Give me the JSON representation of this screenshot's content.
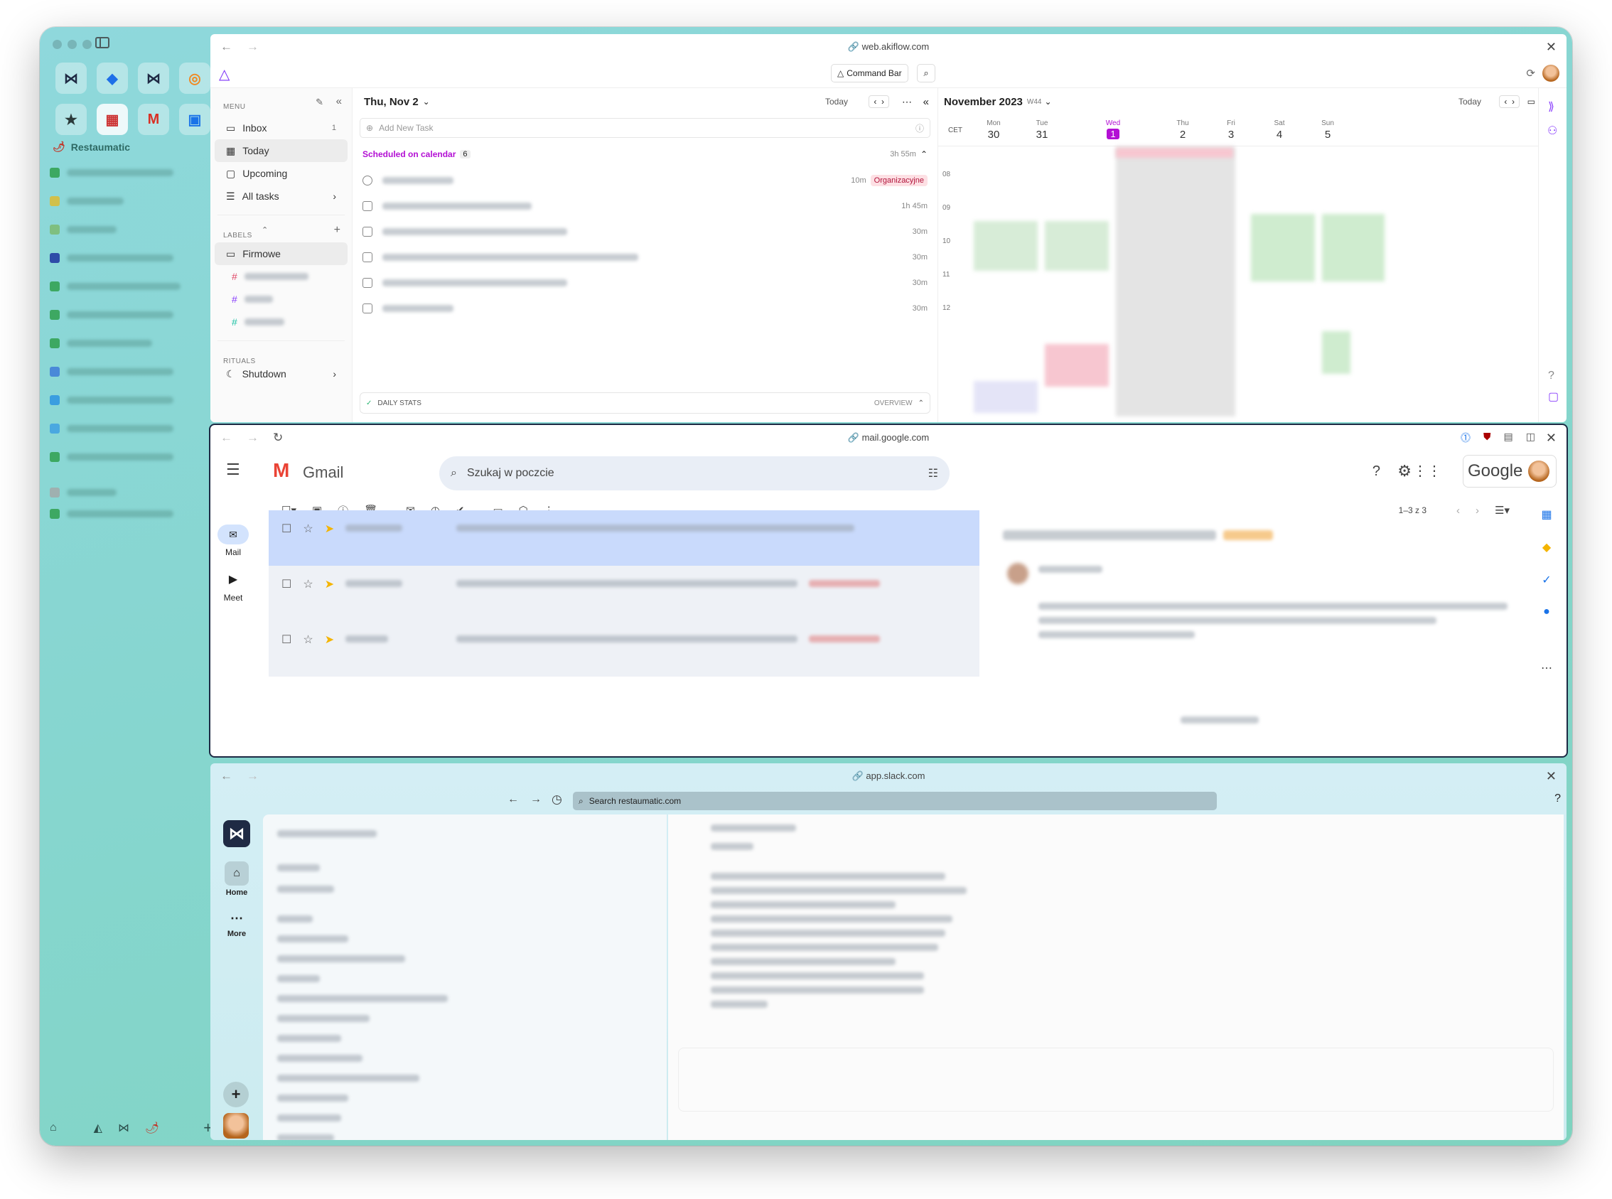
{
  "sidebar": {
    "space_name": "Restaumatic",
    "favorites": [
      {
        "icon": "bowtie-icon",
        "glyph": "⋈",
        "color": "#1f2a44"
      },
      {
        "icon": "jira-icon",
        "glyph": "◆",
        "color": "#1e6fe8"
      },
      {
        "icon": "bowtie-icon",
        "glyph": "⋈",
        "color": "#1f2a44"
      },
      {
        "icon": "app-icon",
        "glyph": "◎",
        "color": "#f08a24"
      },
      {
        "icon": "star-icon",
        "glyph": "★",
        "color": "#2b3a3a"
      },
      {
        "icon": "group-icon",
        "glyph": "▦",
        "color": "#c33"
      },
      {
        "icon": "gmail-icon",
        "glyph": "M",
        "color": "#d93025"
      },
      {
        "icon": "calendar-icon",
        "glyph": "▣",
        "color": "#1a73e8"
      }
    ],
    "tab_dots": [
      "#3da862",
      "#d1c04b",
      "#7fbf80",
      "#2e4ca8",
      "#3da862",
      "#3da862",
      "#3da862",
      "#4a89d8",
      "#3a9ee0",
      "#4aa8e0",
      "#3da862",
      "#9fb0b0",
      "#3da862"
    ]
  },
  "akiflow": {
    "url": "web.akiflow.com",
    "command_bar": "Command Bar",
    "menu_label": "MENU",
    "menu": [
      {
        "label": "Inbox",
        "count": "1"
      },
      {
        "label": "Today",
        "count": ""
      },
      {
        "label": "Upcoming",
        "count": ""
      },
      {
        "label": "All tasks",
        "count": ""
      }
    ],
    "labels_label": "LABELS",
    "label_group": "Firmowe",
    "rituals_label": "RITUALS",
    "ritual": "Shutdown",
    "date_title": "Thu, Nov 2",
    "today_btn": "Today",
    "add_task": "Add New Task",
    "scheduled": "Scheduled on calendar",
    "scheduled_count": "6",
    "scheduled_total": "3h 55m",
    "tasks": [
      {
        "dur": "10m",
        "tag": "Organizacyjne"
      },
      {
        "dur": "1h 45m",
        "tag": ""
      },
      {
        "dur": "30m",
        "tag": ""
      },
      {
        "dur": "30m",
        "tag": ""
      },
      {
        "dur": "30m",
        "tag": ""
      },
      {
        "dur": "30m",
        "tag": ""
      }
    ],
    "daily_stats": "DAILY STATS",
    "overview": "OVERVIEW",
    "cal_title": "November 2023",
    "cal_week": "W44",
    "cal_today": "Today",
    "timezone": "CET",
    "days": [
      {
        "dow": "Mon",
        "num": "30"
      },
      {
        "dow": "Tue",
        "num": "31"
      },
      {
        "dow": "Wed",
        "num": "1"
      },
      {
        "dow": "Thu",
        "num": "2"
      },
      {
        "dow": "Fri",
        "num": "3"
      },
      {
        "dow": "Sat",
        "num": "4"
      },
      {
        "dow": "Sun",
        "num": "5"
      }
    ],
    "hours": [
      "08",
      "09",
      "10",
      "11",
      "12"
    ]
  },
  "gmail": {
    "url": "mail.google.com",
    "brand": "Gmail",
    "search_placeholder": "Szukaj w poczcie",
    "google": "Google",
    "rail": [
      {
        "label": "Mail"
      },
      {
        "label": "Meet"
      }
    ],
    "pagination": "1–3 z 3"
  },
  "slack": {
    "url": "app.slack.com",
    "search_placeholder": "Search restaumatic.com",
    "rail": [
      {
        "label": "Home"
      },
      {
        "label": "More"
      }
    ]
  }
}
